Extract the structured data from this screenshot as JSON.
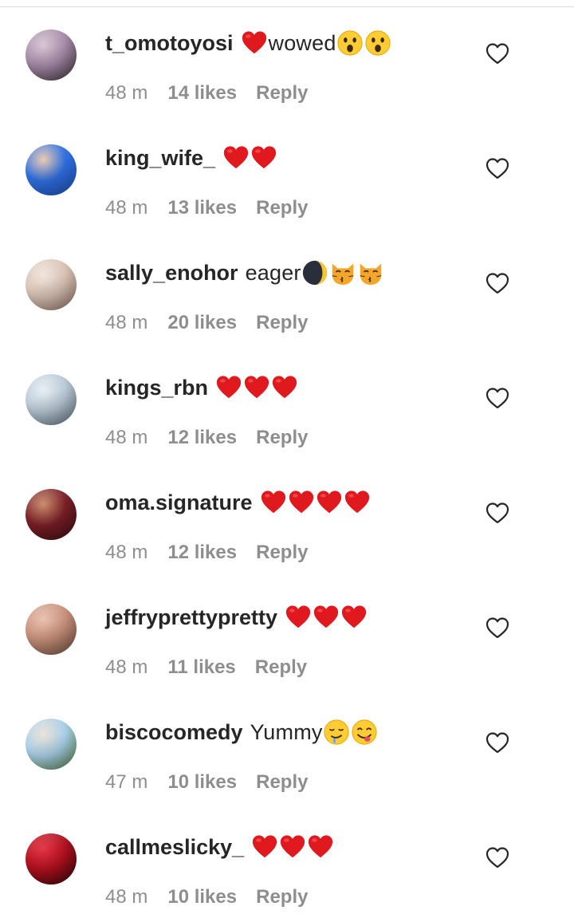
{
  "comments": [
    {
      "username": "t_omotoyosi",
      "pre_emojis": [
        "red-heart"
      ],
      "text": "wowed",
      "post_emojis": [
        "astonished-face",
        "astonished-face"
      ],
      "time": "48 m",
      "likes": "14 likes",
      "reply": "Reply",
      "avatar_colors": [
        "#3b2f35",
        "#a58aa8",
        "#d6c4d2"
      ]
    },
    {
      "username": "king_wife_",
      "pre_emojis": [],
      "text": "",
      "post_emojis": [
        "red-heart",
        "red-heart"
      ],
      "time": "48 m",
      "likes": "13 likes",
      "reply": "Reply",
      "avatar_colors": [
        "#1d4fb8",
        "#2f6fe0",
        "#e8c9b0"
      ]
    },
    {
      "username": "sally_enohor",
      "pre_emojis": [],
      "text": "eager",
      "post_emojis": [
        "crescent-moon",
        "kissing-cat",
        "kissing-cat"
      ],
      "time": "48 m",
      "likes": "20 likes",
      "reply": "Reply",
      "avatar_colors": [
        "#8a6f61",
        "#d9c2b5",
        "#f0e4dc"
      ]
    },
    {
      "username": "kings_rbn",
      "pre_emojis": [],
      "text": "",
      "post_emojis": [
        "red-heart",
        "red-heart",
        "red-heart"
      ],
      "time": "48 m",
      "likes": "12 likes",
      "reply": "Reply",
      "avatar_colors": [
        "#5a6b7a",
        "#b9c9d6",
        "#e6eef3"
      ]
    },
    {
      "username": "oma.signature",
      "pre_emojis": [],
      "text": "",
      "post_emojis": [
        "red-heart",
        "red-heart",
        "red-heart",
        "red-heart"
      ],
      "time": "48 m",
      "likes": "12 likes",
      "reply": "Reply",
      "avatar_colors": [
        "#3a0c10",
        "#7a1f26",
        "#c88a6a"
      ]
    },
    {
      "username": "jeffryprettypretty",
      "pre_emojis": [],
      "text": "",
      "post_emojis": [
        "red-heart",
        "red-heart",
        "red-heart"
      ],
      "time": "48 m",
      "likes": "11 likes",
      "reply": "Reply",
      "avatar_colors": [
        "#6b4a3c",
        "#c7907a",
        "#e8c0ad"
      ]
    },
    {
      "username": "biscocomedy",
      "pre_emojis": [],
      "text": "Yummy",
      "post_emojis": [
        "drooling-face",
        "yum-face"
      ],
      "time": "47 m",
      "likes": "10 likes",
      "reply": "Reply",
      "avatar_colors": [
        "#4d7a3a",
        "#a8cfe8",
        "#e9e2d6"
      ]
    },
    {
      "username": "callmeslicky_",
      "pre_emojis": [],
      "text": "",
      "post_emojis": [
        "red-heart",
        "red-heart",
        "red-heart"
      ],
      "time": "48 m",
      "likes": "10 likes",
      "reply": "Reply",
      "avatar_colors": [
        "#2a0508",
        "#b0101e",
        "#e23040"
      ]
    }
  ],
  "like_icon": "heart-outline-icon",
  "colors": {
    "text": "#262626",
    "meta": "#8e8e8e",
    "heart_red": "#e0191f",
    "divider": "#dbdbdb"
  }
}
